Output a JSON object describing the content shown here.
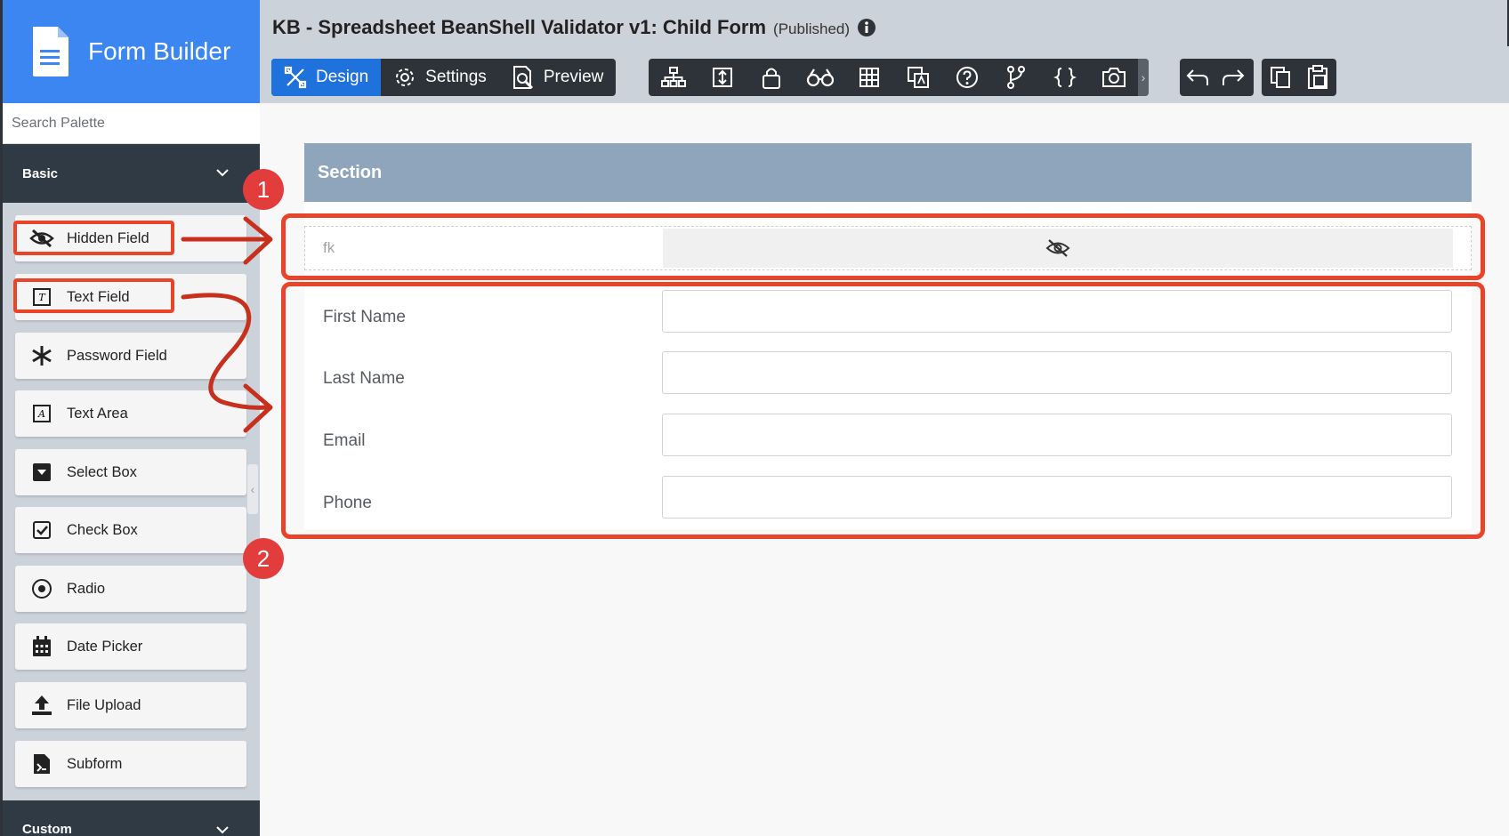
{
  "app": {
    "title": "Form Builder"
  },
  "palette": {
    "search_placeholder": "Search Palette",
    "categories": [
      {
        "label": "Basic"
      },
      {
        "label": "Custom"
      }
    ],
    "items": [
      {
        "label": "Hidden Field",
        "icon": "eye-slash-icon"
      },
      {
        "label": "Text Field",
        "icon": "text-field-icon"
      },
      {
        "label": "Password Field",
        "icon": "asterisk-icon"
      },
      {
        "label": "Text Area",
        "icon": "text-area-icon"
      },
      {
        "label": "Select Box",
        "icon": "select-box-icon"
      },
      {
        "label": "Check Box",
        "icon": "checkbox-icon"
      },
      {
        "label": "Radio",
        "icon": "radio-icon"
      },
      {
        "label": "Date Picker",
        "icon": "calendar-icon"
      },
      {
        "label": "File Upload",
        "icon": "upload-icon"
      },
      {
        "label": "Subform",
        "icon": "subform-icon"
      }
    ]
  },
  "header": {
    "form_title": "KB - Spreadsheet BeanShell Validator v1: Child Form",
    "status": "(Published)",
    "tabs": [
      {
        "label": "Design",
        "icon": "design-icon",
        "active": true
      },
      {
        "label": "Settings",
        "icon": "gear-icon",
        "active": false
      },
      {
        "label": "Preview",
        "icon": "preview-icon",
        "active": false
      }
    ],
    "tools": [
      "tree-icon",
      "form-icon",
      "lock-icon",
      "binoculars-icon",
      "grid-icon",
      "translate-icon",
      "help-icon",
      "branch-icon",
      "code-braces-icon",
      "camera-icon"
    ],
    "history": [
      "undo-icon",
      "redo-icon"
    ],
    "clipboard": [
      "copy-icon",
      "paste-icon"
    ]
  },
  "form": {
    "section_title": "Section",
    "hidden_field": {
      "label": "fk"
    },
    "fields": [
      {
        "label": "First Name",
        "value": ""
      },
      {
        "label": "Last Name",
        "value": ""
      },
      {
        "label": "Email",
        "value": ""
      },
      {
        "label": "Phone",
        "value": ""
      }
    ]
  },
  "annotations": {
    "badges": [
      "1",
      "2"
    ]
  },
  "colors": {
    "brand": "#3b86f0",
    "active_tab": "#1f71dc",
    "dark": "#2d3338",
    "section_header": "#8fa5bc",
    "highlight": "#e8442a",
    "badge": "#e33c3c"
  }
}
